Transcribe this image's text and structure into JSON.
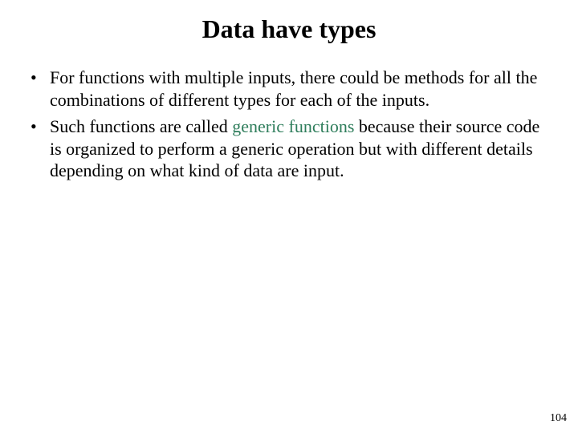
{
  "title": "Data have types",
  "bullets": [
    {
      "pre": "For functions with multiple inputs, there could be methods for all the combinations of different types for each of the inputs.",
      "accent": "",
      "post": ""
    },
    {
      "pre": "Such functions are called ",
      "accent": "generic functions",
      "post": " because their source code is organized to perform a generic operation but with different details depending on what kind of data are input."
    }
  ],
  "page_number": "104",
  "colors": {
    "accent": "#2e7d5b"
  }
}
